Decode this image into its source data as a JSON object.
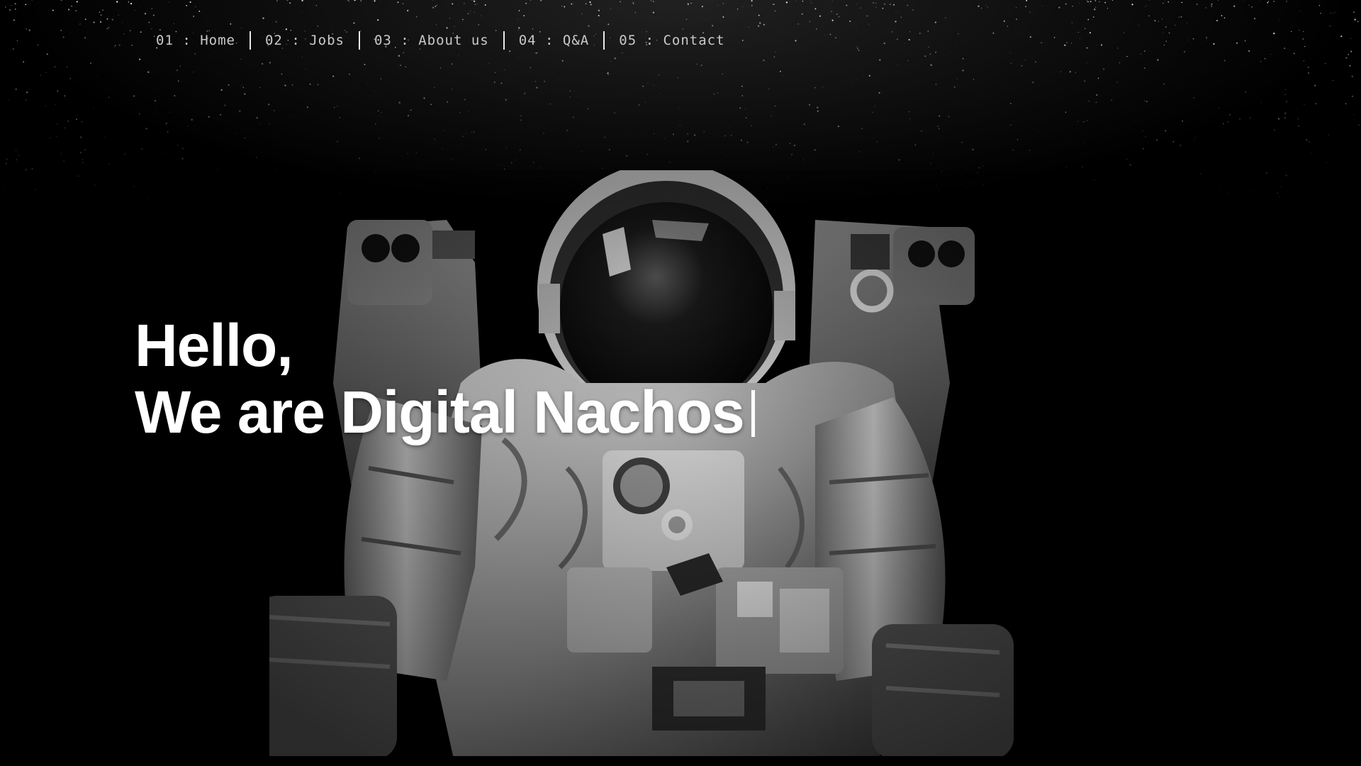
{
  "nav": {
    "items": [
      {
        "number": "01",
        "label": "Home"
      },
      {
        "number": "02",
        "label": "Jobs"
      },
      {
        "number": "03",
        "label": "About us"
      },
      {
        "number": "04",
        "label": "Q&A"
      },
      {
        "number": "05",
        "label": "Contact"
      }
    ],
    "separator": " : "
  },
  "hero": {
    "line1": "Hello,",
    "line2": "We are Digital Nachos"
  },
  "background": {
    "image": "astronaut-photo",
    "color": "#000000"
  }
}
